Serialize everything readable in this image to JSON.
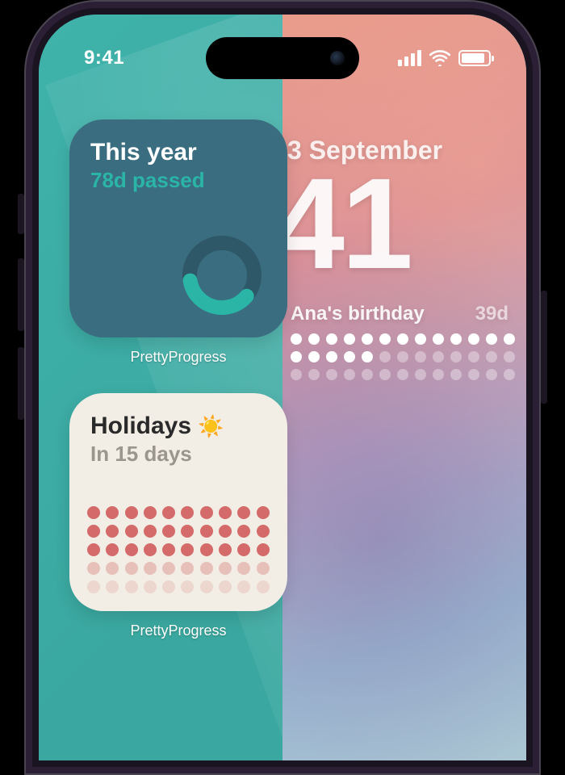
{
  "status_bar": {
    "time": "9:41",
    "signal_bars": 4,
    "wifi": true,
    "battery_percent": 80
  },
  "home_screen": {
    "widgets": [
      {
        "id": "this-year",
        "title": "This year",
        "subtitle": "78d passed",
        "progress_percent": 21,
        "app_label": "PrettyProgress",
        "accent": "#2ab5a6",
        "bg": "#3a6d80"
      },
      {
        "id": "holidays",
        "title": "Holidays",
        "emoji": "☀️",
        "subtitle": "In 15 days",
        "app_label": "PrettyProgress",
        "dot_rows": 5,
        "dot_cols": 10,
        "dot_color": "#d46a6a",
        "faded_start_row": 3,
        "bg": "#f2eee5"
      }
    ]
  },
  "lock_screen": {
    "date_visible": "3 September",
    "time_visible": "41",
    "countdown": {
      "title": "Ana's birthday",
      "remaining": "39d",
      "dot_rows": 3,
      "dot_cols": 13,
      "bright_dots": 18
    }
  }
}
